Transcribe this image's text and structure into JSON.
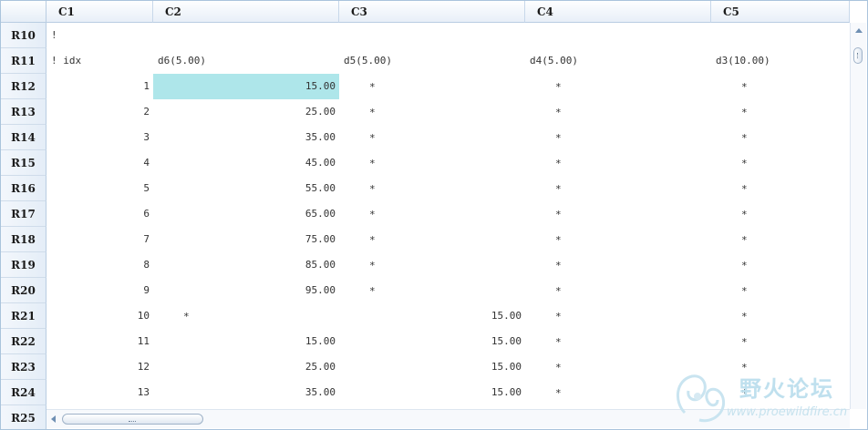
{
  "columns": [
    "C1",
    "C2",
    "C3",
    "C4",
    "C5"
  ],
  "rows": [
    {
      "header": "R10",
      "c1": "!",
      "c1_align": "left",
      "c2": "",
      "c3": "",
      "c4": "",
      "c5": "",
      "stars": []
    },
    {
      "header": "R11",
      "c1": "! idx",
      "c1_align": "left",
      "c2": "d6(5.00)",
      "c2_align": "left",
      "c3": "d5(5.00)",
      "c3_align": "left",
      "c4": "d4(5.00)",
      "c4_align": "left",
      "c5": "d3(10.00)",
      "c5_align": "left",
      "stars": []
    },
    {
      "header": "R12",
      "c1": "1",
      "c2": "15.00",
      "c3": "",
      "c4": "",
      "c5": "",
      "stars": [
        "c3",
        "c4",
        "c5"
      ],
      "selected_cell": "c2"
    },
    {
      "header": "R13",
      "c1": "2",
      "c2": "25.00",
      "c3": "",
      "c4": "",
      "c5": "",
      "stars": [
        "c3",
        "c4",
        "c5"
      ]
    },
    {
      "header": "R14",
      "c1": "3",
      "c2": "35.00",
      "c3": "",
      "c4": "",
      "c5": "",
      "stars": [
        "c3",
        "c4",
        "c5"
      ]
    },
    {
      "header": "R15",
      "c1": "4",
      "c2": "45.00",
      "c3": "",
      "c4": "",
      "c5": "",
      "stars": [
        "c3",
        "c4",
        "c5"
      ]
    },
    {
      "header": "R16",
      "c1": "5",
      "c2": "55.00",
      "c3": "",
      "c4": "",
      "c5": "",
      "stars": [
        "c3",
        "c4",
        "c5"
      ]
    },
    {
      "header": "R17",
      "c1": "6",
      "c2": "65.00",
      "c3": "",
      "c4": "",
      "c5": "",
      "stars": [
        "c3",
        "c4",
        "c5"
      ]
    },
    {
      "header": "R18",
      "c1": "7",
      "c2": "75.00",
      "c3": "",
      "c4": "",
      "c5": "",
      "stars": [
        "c3",
        "c4",
        "c5"
      ]
    },
    {
      "header": "R19",
      "c1": "8",
      "c2": "85.00",
      "c3": "",
      "c4": "",
      "c5": "",
      "stars": [
        "c3",
        "c4",
        "c5"
      ]
    },
    {
      "header": "R20",
      "c1": "9",
      "c2": "95.00",
      "c3": "",
      "c4": "",
      "c5": "",
      "stars": [
        "c3",
        "c4",
        "c5"
      ]
    },
    {
      "header": "R21",
      "c1": "10",
      "c2": "",
      "c3": "15.00",
      "c4": "",
      "c5": "",
      "stars": [
        "c2",
        "c4",
        "c5"
      ]
    },
    {
      "header": "R22",
      "c1": "11",
      "c2": "15.00",
      "c3": "15.00",
      "c4": "",
      "c5": "",
      "stars": [
        "c4",
        "c5"
      ]
    },
    {
      "header": "R23",
      "c1": "12",
      "c2": "25.00",
      "c3": "15.00",
      "c4": "",
      "c5": "",
      "stars": [
        "c4",
        "c5"
      ]
    },
    {
      "header": "R24",
      "c1": "13",
      "c2": "35.00",
      "c3": "15.00",
      "c4": "",
      "c5": "",
      "stars": [
        "c4",
        "c5"
      ]
    },
    {
      "header": "R25",
      "c1": "",
      "c2": "",
      "c3": "",
      "c4": "",
      "c5": "",
      "stars": []
    }
  ],
  "star_glyph": "*",
  "watermark": {
    "text": "野火论坛",
    "url": "www.proewildfire.cn"
  },
  "colors": {
    "selected": "#aee6ea",
    "border": "#aac4dc",
    "header_bg": "#e8eff8"
  }
}
